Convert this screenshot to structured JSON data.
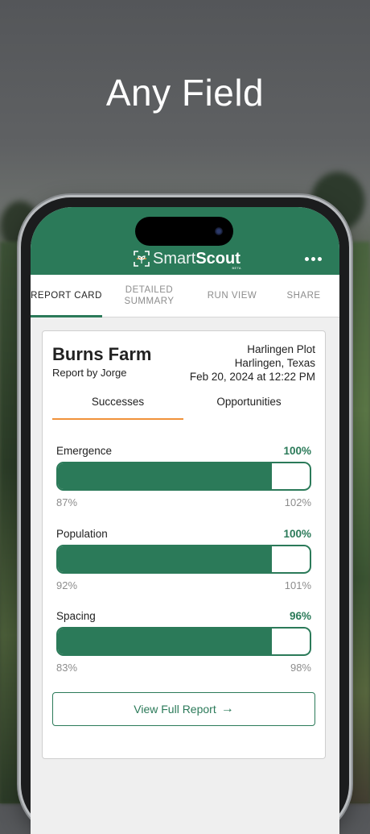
{
  "headline": "Any Field",
  "app": {
    "brand_left": "Smart",
    "brand_right": "Scout",
    "brand_badge": "BETA"
  },
  "tabs": [
    {
      "label": "REPORT CARD",
      "active": true
    },
    {
      "label": "DETAILED SUMMARY",
      "active": false
    },
    {
      "label": "RUN VIEW",
      "active": false
    },
    {
      "label": "SHARE",
      "active": false
    }
  ],
  "report": {
    "farm": "Burns Farm",
    "byline": "Report by Jorge",
    "plot": "Harlingen Plot",
    "location": "Harlingen, Texas",
    "datetime": "Feb 20, 2024 at 12:22 PM",
    "subtabs": [
      {
        "label": "Successes",
        "active": true
      },
      {
        "label": "Opportunities",
        "active": false
      }
    ],
    "metrics": [
      {
        "name": "Emergence",
        "percent": "100%",
        "fill_fraction": 0.85,
        "min": "87%",
        "max": "102%"
      },
      {
        "name": "Population",
        "percent": "100%",
        "fill_fraction": 0.85,
        "min": "92%",
        "max": "101%"
      },
      {
        "name": "Spacing",
        "percent": "96%",
        "fill_fraction": 0.85,
        "min": "83%",
        "max": "98%"
      }
    ],
    "full_report_label": "View Full Report"
  },
  "colors": {
    "brand": "#2b7a59",
    "accent": "#f0923a"
  },
  "icons": [
    "scan-frame-logo-icon",
    "more-horizontal-icon",
    "arrow-right-icon"
  ]
}
